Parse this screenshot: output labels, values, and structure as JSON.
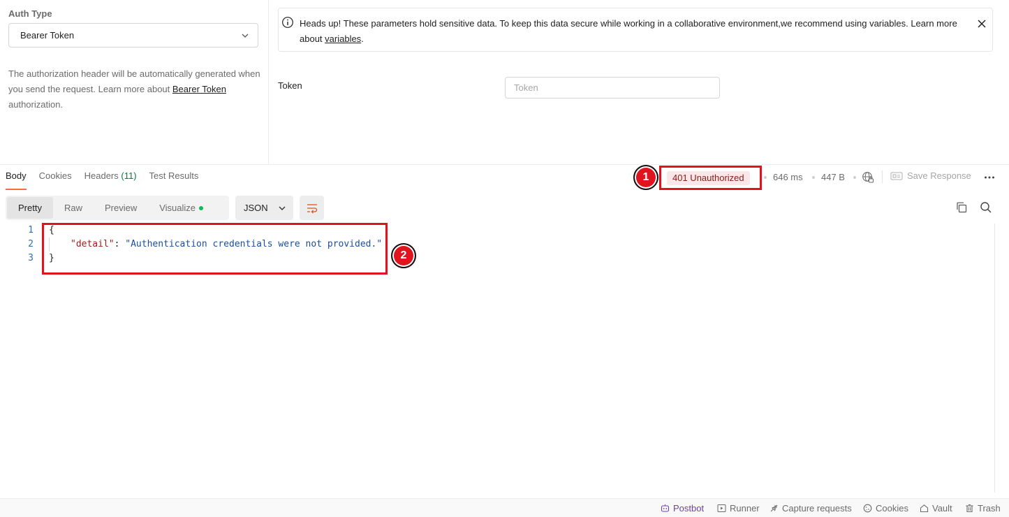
{
  "auth": {
    "type_label": "Auth Type",
    "type_value": "Bearer Token",
    "desc_before": "The authorization header will be automatically generated when you send the request. Learn more about ",
    "desc_link": "Bearer Token",
    "desc_after": " authorization."
  },
  "notice": {
    "text_before": "Heads up! These parameters hold sensitive data. To keep this data secure while working in a collaborative environment,we recommend using variables. Learn more about ",
    "link": "variables",
    "text_after": "."
  },
  "token": {
    "label": "Token",
    "value": "",
    "placeholder": "Token"
  },
  "response": {
    "tabs": [
      {
        "label": "Body",
        "active": true
      },
      {
        "label": "Cookies"
      },
      {
        "label": "Headers",
        "count": "(11)"
      },
      {
        "label": "Test Results"
      }
    ],
    "status": "401 Unauthorized",
    "time": "646 ms",
    "size": "447 B",
    "save_label": "Save Response",
    "view_modes": [
      "Pretty",
      "Raw",
      "Preview",
      "Visualize"
    ],
    "format": "JSON",
    "code": {
      "line_numbers": [
        "1",
        "2",
        "3"
      ],
      "open_brace": "{",
      "key": "\"detail\"",
      "colon": ": ",
      "value": "\"Authentication credentials were not provided.\"",
      "close_brace": "}"
    }
  },
  "markers": [
    "1",
    "2"
  ],
  "statusbar": {
    "postbot": "Postbot",
    "runner": "Runner",
    "capture": "Capture requests",
    "cookies": "Cookies",
    "vault": "Vault",
    "trash": "Trash"
  },
  "colors": {
    "accent": "#ff6c37",
    "error_badge_bg": "#fbe7e7",
    "error_text": "#8b1a1a",
    "highlight": "#e0141e",
    "json_key": "#a01c1c",
    "json_string": "#1a4fa0",
    "postbot": "#6b3fb5",
    "visualize_dot": "#0cbb52"
  },
  "icons": [
    "chevron-down-icon",
    "info-icon",
    "close-icon",
    "globe-lock-icon",
    "save-icon",
    "more-icon",
    "wrap-lines-icon",
    "copy-icon",
    "search-icon",
    "postbot-icon",
    "runner-icon",
    "capture-icon",
    "cookie-icon",
    "vault-icon",
    "trash-icon"
  ]
}
